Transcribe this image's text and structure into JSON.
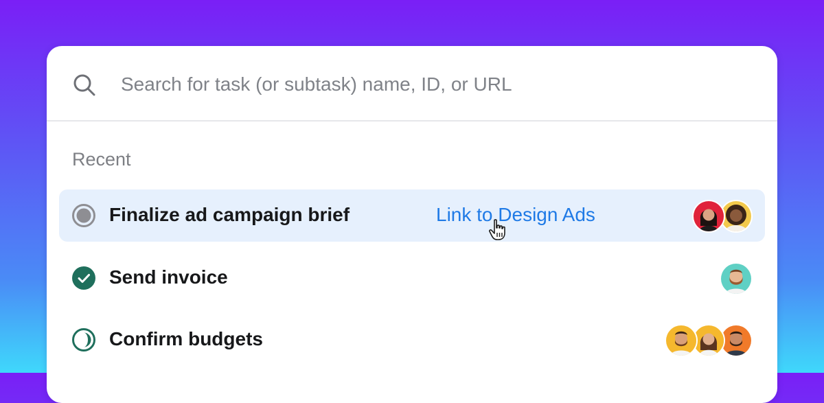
{
  "search": {
    "placeholder": "Search for task (or subtask) name, ID, or URL",
    "icon": "search-icon"
  },
  "recent": {
    "label": "Recent",
    "tasks": [
      {
        "name": "Finalize ad campaign brief",
        "status": "in-progress",
        "status_color": "#8e8e93",
        "link_label": "Link to Design Ads",
        "highlighted": true,
        "avatar_count": 2
      },
      {
        "name": "Send invoice",
        "status": "complete",
        "status_color": "#1f6f5c",
        "link_label": "",
        "highlighted": false,
        "avatar_count": 1
      },
      {
        "name": "Confirm budgets",
        "status": "partial",
        "status_color": "#1f6f5c",
        "link_label": "",
        "highlighted": false,
        "avatar_count": 3
      }
    ]
  },
  "colors": {
    "accent": "#1f7ae6",
    "highlight_bg": "#e6f0fd",
    "gradient_top": "#7a1ff6",
    "gradient_bottom": "#3fd8fb"
  }
}
